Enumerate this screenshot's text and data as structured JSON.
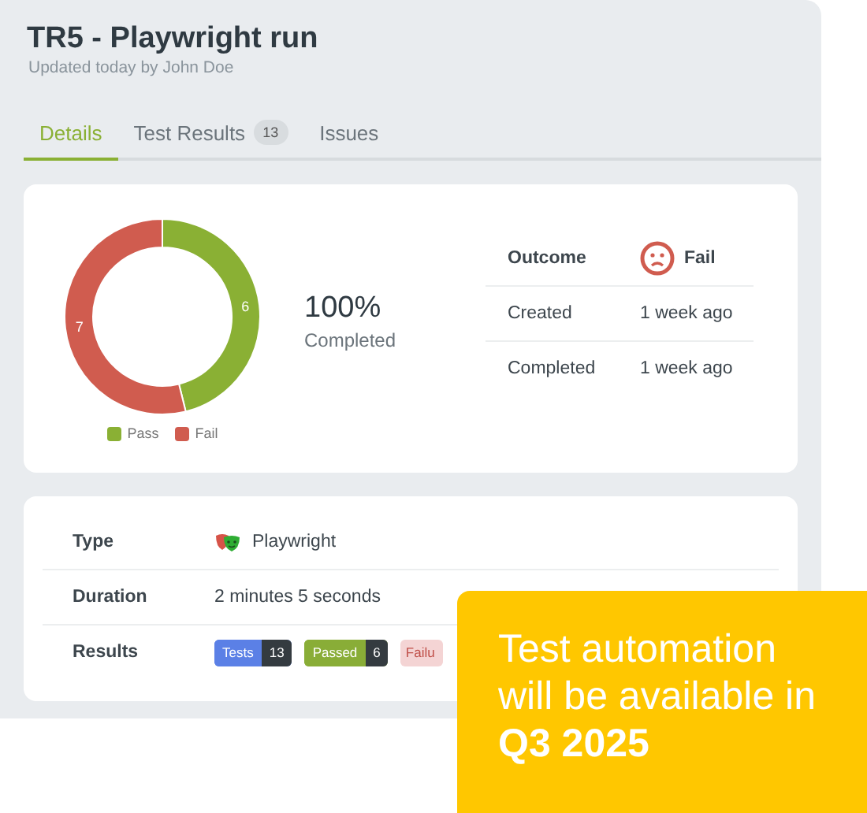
{
  "header": {
    "title": "TR5 - Playwright run",
    "subtitle": "Updated today by John Doe"
  },
  "tabs": [
    {
      "label": "Details",
      "selected": true
    },
    {
      "label": "Test Results",
      "badge": "13",
      "selected": false
    },
    {
      "label": "Issues",
      "selected": false
    }
  ],
  "summary": {
    "chart_data": {
      "type": "donut",
      "categories": [
        "Pass",
        "Fail"
      ],
      "values": [
        6,
        7
      ],
      "colors": [
        "#8ab034",
        "#d05c4f"
      ],
      "data_labels": true
    },
    "percent": "100%",
    "percent_label": "Completed",
    "details": [
      {
        "label": "Outcome",
        "value": "Fail",
        "kind": "outcome"
      },
      {
        "label": "Created",
        "value": "1 week ago",
        "kind": "text"
      },
      {
        "label": "Completed",
        "value": "1 week ago",
        "kind": "text"
      }
    ]
  },
  "info": [
    {
      "label": "Type",
      "value": "Playwright",
      "kind": "tool"
    },
    {
      "label": "Duration",
      "value": "2 minutes 5 seconds",
      "kind": "text"
    },
    {
      "label": "Results",
      "kind": "badges",
      "badges": [
        {
          "label": "Tests",
          "count": "13",
          "color": "#5b80e6",
          "kind": "solid"
        },
        {
          "label": "Passed",
          "count": "6",
          "color": "#89ad37",
          "kind": "solid"
        },
        {
          "label": "Failu",
          "color": "#f4d4d4",
          "kind": "soft"
        }
      ]
    }
  ],
  "callout": {
    "text": "Test automation will be available in **Q3 2025**"
  }
}
